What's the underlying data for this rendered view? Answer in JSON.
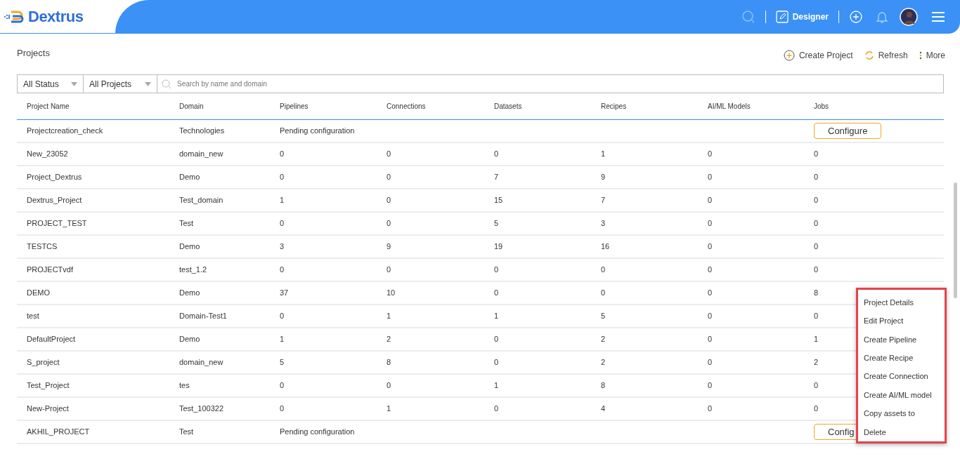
{
  "header": {
    "logo": "Dextrus",
    "mode": "Designer"
  },
  "page": {
    "title": "Projects",
    "actions": [
      "Create Project",
      "Refresh",
      "More"
    ]
  },
  "filters": {
    "status": "All Status",
    "projects": "All Projects",
    "search_placeholder": "Search by name and domain"
  },
  "table": {
    "columns": [
      "Project Name",
      "Domain",
      "Pipelines",
      "Connections",
      "Datasets",
      "Recipes",
      "AI/ML Models",
      "Jobs"
    ],
    "rows": [
      {
        "kind": "pending",
        "cells": [
          "Projectcreation_check",
          "Technologies"
        ],
        "status": "Pending configuration",
        "button": "Configure"
      },
      {
        "kind": "stats",
        "cells": [
          "New_23052",
          "domain_new",
          "0",
          "0",
          "0",
          "1",
          "0",
          "0"
        ]
      },
      {
        "kind": "stats",
        "cells": [
          "Project_Dextrus",
          "Demo",
          "0",
          "0",
          "7",
          "9",
          "0",
          "0"
        ]
      },
      {
        "kind": "stats",
        "cells": [
          "Dextrus_Project",
          "Test_domain",
          "1",
          "0",
          "15",
          "7",
          "0",
          "0"
        ]
      },
      {
        "kind": "stats",
        "cells": [
          "PROJECT_TEST",
          "Test",
          "0",
          "0",
          "5",
          "3",
          "0",
          "0"
        ]
      },
      {
        "kind": "stats",
        "cells": [
          "TESTCS",
          "Demo",
          "3",
          "9",
          "19",
          "16",
          "0",
          "0"
        ]
      },
      {
        "kind": "stats",
        "cells": [
          "PROJECTvdf",
          "test_1.2",
          "0",
          "0",
          "0",
          "0",
          "0",
          "0"
        ]
      },
      {
        "kind": "stats",
        "cells": [
          "DEMO",
          "Demo",
          "37",
          "10",
          "0",
          "0",
          "0",
          "8"
        ]
      },
      {
        "kind": "stats",
        "cells": [
          "test",
          "Domain-Test1",
          "0",
          "1",
          "1",
          "5",
          "0",
          "0"
        ]
      },
      {
        "kind": "stats",
        "cells": [
          "DefaultProject",
          "Demo",
          "1",
          "2",
          "0",
          "2",
          "0",
          "1"
        ]
      },
      {
        "kind": "stats",
        "cells": [
          "S_project",
          "domain_new",
          "5",
          "8",
          "0",
          "2",
          "0",
          "2"
        ]
      },
      {
        "kind": "stats",
        "cells": [
          "Test_Project",
          "tes",
          "0",
          "0",
          "1",
          "8",
          "0",
          "0"
        ]
      },
      {
        "kind": "stats",
        "cells": [
          "New-Project",
          "Test_100322",
          "0",
          "1",
          "0",
          "4",
          "0",
          "0"
        ]
      },
      {
        "kind": "pending",
        "cells": [
          "AKHIL_PROJECT",
          "Test"
        ],
        "status": "Pending configuration",
        "button": "Config"
      }
    ]
  },
  "context_menu": [
    "Project Details",
    "Edit Project",
    "Create Pipeline",
    "Create Recipe",
    "Create Connection",
    "Create AI/ML model",
    "Copy assets to",
    "Delete"
  ]
}
